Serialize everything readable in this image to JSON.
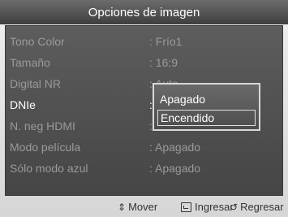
{
  "title": "Opciones de imagen",
  "menu": [
    {
      "label": "Tono Color",
      "value": ": Frío1",
      "state": "dim"
    },
    {
      "label": "Tamaño",
      "value": ": 16:9",
      "state": "dim"
    },
    {
      "label": "Digital NR",
      "value": ": Auto",
      "state": "dim"
    },
    {
      "label": "DNIe",
      "value": ":",
      "state": "active"
    },
    {
      "label": "N. neg HDMI",
      "value": ":",
      "state": "dim"
    },
    {
      "label": "Modo película",
      "value": ": Apagado",
      "state": "dim"
    },
    {
      "label": "Sólo modo azul",
      "value": ": Apagado",
      "state": "dim"
    }
  ],
  "dropdown": {
    "options": [
      "Apagado",
      "Encendido"
    ],
    "selected": "Encendido"
  },
  "footer": {
    "move": "Mover",
    "enter": "Ingresar",
    "back": "Regresar",
    "move_icon": "up-down-arrow-icon",
    "enter_icon": "enter-icon",
    "back_icon": "return-icon"
  }
}
